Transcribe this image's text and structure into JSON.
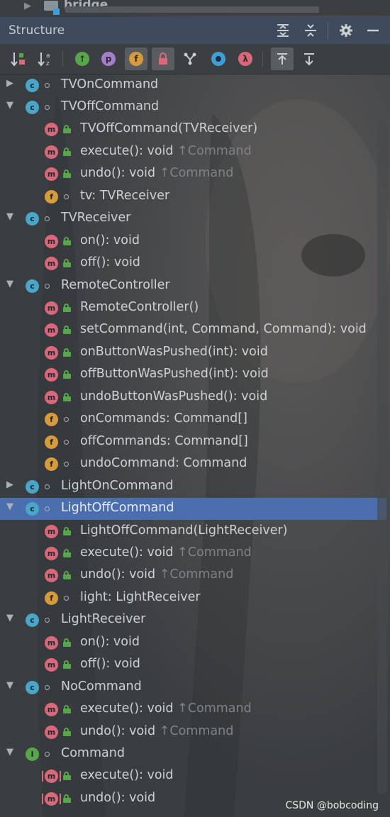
{
  "top": {
    "label": "bridge"
  },
  "header": {
    "title": "Structure"
  },
  "toolbar": {
    "visibility_letter_p": "p",
    "fields_letter_f": "f",
    "lambda_symbol": "λ"
  },
  "colors": {
    "header_bg": "#3d4b5c",
    "panel_bg": "#3c3f41",
    "selection": "#4b6eaf",
    "class_badge": "#4aa6c9",
    "method_badge": "#d9687a",
    "field_badge": "#d79b3b",
    "interface_badge": "#57a64a",
    "public_lock": "#57a64a"
  },
  "tree": [
    {
      "kind": "class",
      "text": "TVOnCommand",
      "inherited": "",
      "expander": "collapsed",
      "level": 0,
      "selected": false
    },
    {
      "kind": "class",
      "text": "TVOffCommand",
      "inherited": "",
      "expander": "expanded",
      "level": 0,
      "selected": false
    },
    {
      "kind": "method",
      "text": "TVOffCommand(TVReceiver)",
      "inherited": "",
      "level": 1,
      "access": "public"
    },
    {
      "kind": "method",
      "text": "execute(): void ",
      "inherited": "↑Command",
      "level": 1,
      "access": "public"
    },
    {
      "kind": "method",
      "text": "undo(): void ",
      "inherited": "↑Command",
      "level": 1,
      "access": "public"
    },
    {
      "kind": "field",
      "text": "tv: TVReceiver",
      "inherited": "",
      "level": 1,
      "access": "package"
    },
    {
      "kind": "class",
      "text": "TVReceiver",
      "inherited": "",
      "expander": "expanded",
      "level": 0,
      "selected": false
    },
    {
      "kind": "method",
      "text": "on(): void",
      "inherited": "",
      "level": 1,
      "access": "public"
    },
    {
      "kind": "method",
      "text": "off(): void",
      "inherited": "",
      "level": 1,
      "access": "public"
    },
    {
      "kind": "class",
      "text": "RemoteController",
      "inherited": "",
      "expander": "expanded",
      "level": 0,
      "selected": false
    },
    {
      "kind": "method",
      "text": "RemoteController()",
      "inherited": "",
      "level": 1,
      "access": "public"
    },
    {
      "kind": "method",
      "text": "setCommand(int, Command, Command): void",
      "inherited": "",
      "level": 1,
      "access": "public"
    },
    {
      "kind": "method",
      "text": "onButtonWasPushed(int): void",
      "inherited": "",
      "level": 1,
      "access": "public"
    },
    {
      "kind": "method",
      "text": "offButtonWasPushed(int): void",
      "inherited": "",
      "level": 1,
      "access": "public"
    },
    {
      "kind": "method",
      "text": "undoButtonWasPushed(): void",
      "inherited": "",
      "level": 1,
      "access": "public"
    },
    {
      "kind": "field",
      "text": "onCommands: Command[]",
      "inherited": "",
      "level": 1,
      "access": "package"
    },
    {
      "kind": "field",
      "text": "offCommands: Command[]",
      "inherited": "",
      "level": 1,
      "access": "package"
    },
    {
      "kind": "field",
      "text": "undoCommand: Command",
      "inherited": "",
      "level": 1,
      "access": "package"
    },
    {
      "kind": "class",
      "text": "LightOnCommand",
      "inherited": "",
      "expander": "collapsed",
      "level": 0,
      "selected": false
    },
    {
      "kind": "class",
      "text": "LightOffCommand",
      "inherited": "",
      "expander": "expanded",
      "level": 0,
      "selected": true
    },
    {
      "kind": "method",
      "text": "LightOffCommand(LightReceiver)",
      "inherited": "",
      "level": 1,
      "access": "public"
    },
    {
      "kind": "method",
      "text": "execute(): void ",
      "inherited": "↑Command",
      "level": 1,
      "access": "public"
    },
    {
      "kind": "method",
      "text": "undo(): void ",
      "inherited": "↑Command",
      "level": 1,
      "access": "public"
    },
    {
      "kind": "field",
      "text": "light: LightReceiver",
      "inherited": "",
      "level": 1,
      "access": "package"
    },
    {
      "kind": "class",
      "text": "LightReceiver",
      "inherited": "",
      "expander": "expanded",
      "level": 0,
      "selected": false
    },
    {
      "kind": "method",
      "text": "on(): void",
      "inherited": "",
      "level": 1,
      "access": "public"
    },
    {
      "kind": "method",
      "text": "off(): void",
      "inherited": "",
      "level": 1,
      "access": "public"
    },
    {
      "kind": "class",
      "text": "NoCommand",
      "inherited": "",
      "expander": "expanded",
      "level": 0,
      "selected": false
    },
    {
      "kind": "method",
      "text": "execute(): void ",
      "inherited": "↑Command",
      "level": 1,
      "access": "public"
    },
    {
      "kind": "method",
      "text": "undo(): void ",
      "inherited": "↑Command",
      "level": 1,
      "access": "public"
    },
    {
      "kind": "interface",
      "text": "Command",
      "inherited": "",
      "expander": "expanded",
      "level": 0,
      "selected": false
    },
    {
      "kind": "abstract-method",
      "text": "execute(): void",
      "inherited": "",
      "level": 1,
      "access": "public"
    },
    {
      "kind": "abstract-method",
      "text": "undo(): void",
      "inherited": "",
      "level": 1,
      "access": "public"
    }
  ],
  "watermark": "CSDN @bobcoding"
}
